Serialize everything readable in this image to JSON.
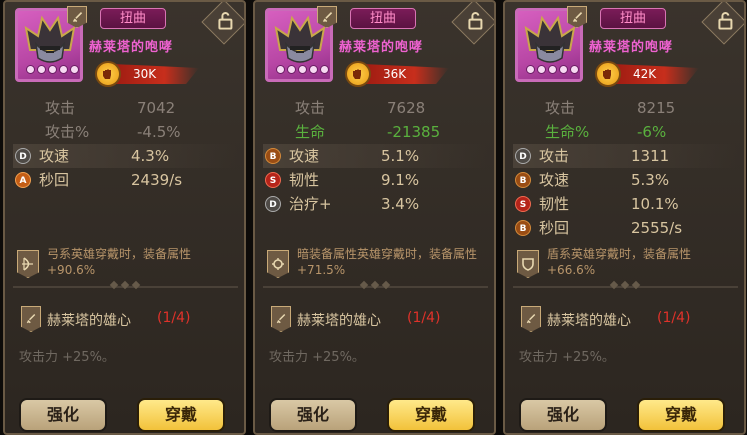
{
  "panels": [
    {
      "twist_label": "扭曲",
      "item_name": "赫莱塔的咆哮",
      "power": "30K",
      "base_stats": [
        {
          "label": "攻击",
          "value": "7042",
          "style": "base"
        },
        {
          "label": "攻击%",
          "value": "-4.5%",
          "style": "base"
        }
      ],
      "sub_stats": [
        {
          "grade": "D",
          "label": "攻速",
          "value": "4.3%"
        },
        {
          "grade": "A",
          "label": "秒回",
          "value": "2439/s"
        }
      ],
      "bonus_text": "弓系英雄穿戴时，装备属性 +90.6%",
      "bonus_icon": "bow-icon",
      "set_name": "赫莱塔的雄心",
      "set_count": "(1/4)",
      "set_effect": "攻击力 +25%。",
      "enhance_label": "强化",
      "equip_label": "穿戴"
    },
    {
      "twist_label": "扭曲",
      "item_name": "赫莱塔的咆哮",
      "power": "36K",
      "base_stats": [
        {
          "label": "攻击",
          "value": "7628",
          "style": "base"
        },
        {
          "label": "生命",
          "value": "-21385",
          "style": "green"
        }
      ],
      "sub_stats": [
        {
          "grade": "B",
          "label": "攻速",
          "value": "5.1%"
        },
        {
          "grade": "S",
          "label": "韧性",
          "value": "9.1%"
        },
        {
          "grade": "D",
          "label": "治疗+",
          "value": "3.4%"
        }
      ],
      "bonus_text": "暗装备属性英雄穿戴时，装备属性 +71.5%",
      "bonus_icon": "dark-orb-icon",
      "set_name": "赫莱塔的雄心",
      "set_count": "(1/4)",
      "set_effect": "攻击力 +25%。",
      "enhance_label": "强化",
      "equip_label": "穿戴"
    },
    {
      "twist_label": "扭曲",
      "item_name": "赫莱塔的咆哮",
      "power": "42K",
      "base_stats": [
        {
          "label": "攻击",
          "value": "8215",
          "style": "base"
        },
        {
          "label": "生命%",
          "value": "-6%",
          "style": "green"
        }
      ],
      "sub_stats": [
        {
          "grade": "D",
          "label": "攻击",
          "value": "1311"
        },
        {
          "grade": "B",
          "label": "攻速",
          "value": "5.3%"
        },
        {
          "grade": "S",
          "label": "韧性",
          "value": "10.1%"
        },
        {
          "grade": "B",
          "label": "秒回",
          "value": "2555/s"
        }
      ],
      "bonus_text": "盾系英雄穿戴时，装备属性 +66.6%",
      "bonus_icon": "shield-icon",
      "set_name": "赫莱塔的雄心",
      "set_count": "(1/4)",
      "set_effect": "攻击力 +25%。",
      "enhance_label": "强化",
      "equip_label": "穿戴"
    }
  ],
  "colors": {
    "item_name": "#ee62d0",
    "twist": "#ff8cc8",
    "set_count": "#e0322a",
    "stat_green": "#5ab13e",
    "power_bar": "#c72e1c"
  }
}
